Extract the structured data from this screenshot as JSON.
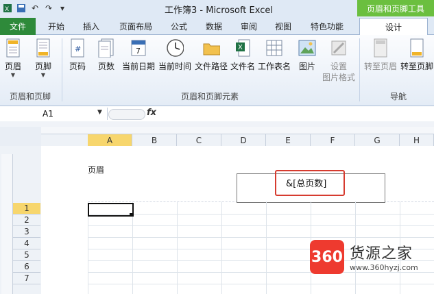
{
  "window": {
    "title": "工作簿3 - Microsoft Excel",
    "context_tab_title": "页眉和页脚工具"
  },
  "tabs": [
    {
      "label": "文件"
    },
    {
      "label": "开始"
    },
    {
      "label": "插入"
    },
    {
      "label": "页面布局"
    },
    {
      "label": "公式"
    },
    {
      "label": "数据"
    },
    {
      "label": "审阅"
    },
    {
      "label": "视图"
    },
    {
      "label": "特色功能"
    },
    {
      "label": "设计"
    }
  ],
  "ribbon": {
    "groups": [
      {
        "label": "页眉和页脚"
      },
      {
        "label": "页眉和页脚元素"
      },
      {
        "label": "导航"
      }
    ],
    "buttons": [
      {
        "label": "页眉",
        "icon": "page-header-icon"
      },
      {
        "label": "页脚",
        "icon": "page-footer-icon"
      },
      {
        "label": "页码",
        "icon": "page-number-icon"
      },
      {
        "label": "页数",
        "icon": "page-count-icon"
      },
      {
        "label": "当前日期",
        "icon": "calendar-icon"
      },
      {
        "label": "当前时间",
        "icon": "clock-icon"
      },
      {
        "label": "文件路径",
        "icon": "folder-icon"
      },
      {
        "label": "文件名",
        "icon": "excel-file-icon"
      },
      {
        "label": "工作表名",
        "icon": "sheet-icon"
      },
      {
        "label": "图片",
        "icon": "picture-icon"
      },
      {
        "label": "设置",
        "label2": "图片格式",
        "icon": "format-picture-icon"
      },
      {
        "label": "转至页眉",
        "icon": "goto-header-icon"
      },
      {
        "label": "转至页脚",
        "icon": "goto-footer-icon"
      }
    ]
  },
  "formula_bar": {
    "name_box": "A1",
    "fx": "fx"
  },
  "columns": [
    "A",
    "B",
    "C",
    "D",
    "E",
    "F",
    "G",
    "H"
  ],
  "rows": [
    "1",
    "2",
    "3",
    "4",
    "5",
    "6",
    "7"
  ],
  "page": {
    "header_label": "页眉",
    "header_code": "&[总页数]"
  },
  "watermark": {
    "badge": "360",
    "name": "货源之家",
    "url": "www.360hyzj.com"
  },
  "colors": {
    "file_tab": "#2e8a3a",
    "context_tab": "#6bbf3f",
    "highlight": "#d63b2f",
    "selected_header": "#f7d66d"
  }
}
